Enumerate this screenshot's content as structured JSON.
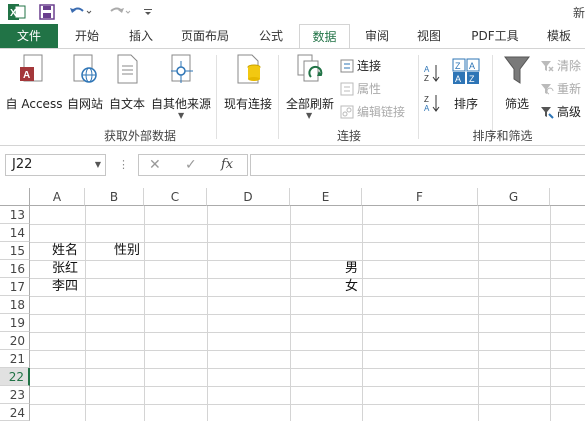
{
  "title_bar": {
    "title_partial": "新"
  },
  "tabs": [
    {
      "label": "文件"
    },
    {
      "label": "开始"
    },
    {
      "label": "插入"
    },
    {
      "label": "页面布局"
    },
    {
      "label": "公式"
    },
    {
      "label": "数据"
    },
    {
      "label": "审阅"
    },
    {
      "label": "视图"
    },
    {
      "label": "PDF工具"
    },
    {
      "label": "模板"
    }
  ],
  "ribbon": {
    "external_data": {
      "buttons": [
        "自 Access",
        "自网站",
        "自文本",
        "自其他来源"
      ],
      "existing": "现有连接",
      "group_label": "获取外部数据"
    },
    "connections": {
      "refresh_all": "全部刷新",
      "connections": "连接",
      "properties": "属性",
      "edit_links": "编辑链接",
      "group_label": "连接"
    },
    "sort_filter": {
      "sort": "排序",
      "filter": "筛选",
      "clear": "清除",
      "reapply": "重新",
      "advanced": "高级",
      "group_label": "排序和筛选"
    }
  },
  "formula_bar": {
    "name_box": "J22",
    "fx": "fx"
  },
  "columns": [
    "A",
    "B",
    "C",
    "D",
    "E",
    "F",
    "G"
  ],
  "rows": [
    "13",
    "14",
    "15",
    "16",
    "17",
    "18",
    "19",
    "20",
    "21",
    "22",
    "23",
    "24"
  ],
  "selected_row": "22",
  "cells": {
    "A15": "姓名",
    "B15": "性别",
    "A16": "张红",
    "E16": "男",
    "A17": "李四",
    "E17": "女"
  },
  "colors": {
    "accent": "#217346"
  }
}
